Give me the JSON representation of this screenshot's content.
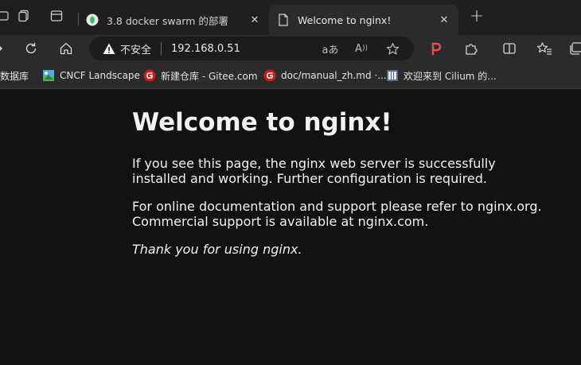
{
  "browser": {
    "tabs": [
      {
        "title": "3.8 docker swarm 的部署",
        "favicon": "green-leaf-icon",
        "active": false
      },
      {
        "title": "Welcome to nginx!",
        "favicon": "page-icon",
        "active": true
      }
    ],
    "address_bar": {
      "security_label": "不安全",
      "url": "192.168.0.51"
    },
    "bookmarks": [
      {
        "label": "数据库",
        "icon": "folder-icon"
      },
      {
        "label": "CNCF Landscape",
        "icon": "cncf-icon"
      },
      {
        "label": "新建仓库 - Gitee.com",
        "icon": "gitee-icon"
      },
      {
        "label": "doc/manual_zh.md ·...",
        "icon": "gitee-icon"
      },
      {
        "label": "欢迎来到 Cilium 的...",
        "icon": "cilium-icon"
      }
    ],
    "colors": {
      "accent_red": "#e05252",
      "gitee_red": "#c71d23",
      "green_favicon": "#3dbb63"
    }
  },
  "page": {
    "heading": "Welcome to nginx!",
    "paragraph1": "If you see this page, the nginx web server is successfully installed and working. Further configuration is required.",
    "paragraph2_prefix": "For online documentation and support please refer to ",
    "paragraph2_link1": "nginx.org",
    "paragraph2_mid": ".\nCommercial support is available at ",
    "paragraph2_link2": "nginx.com",
    "paragraph2_suffix": ".",
    "thanks": "Thank you for using nginx."
  }
}
